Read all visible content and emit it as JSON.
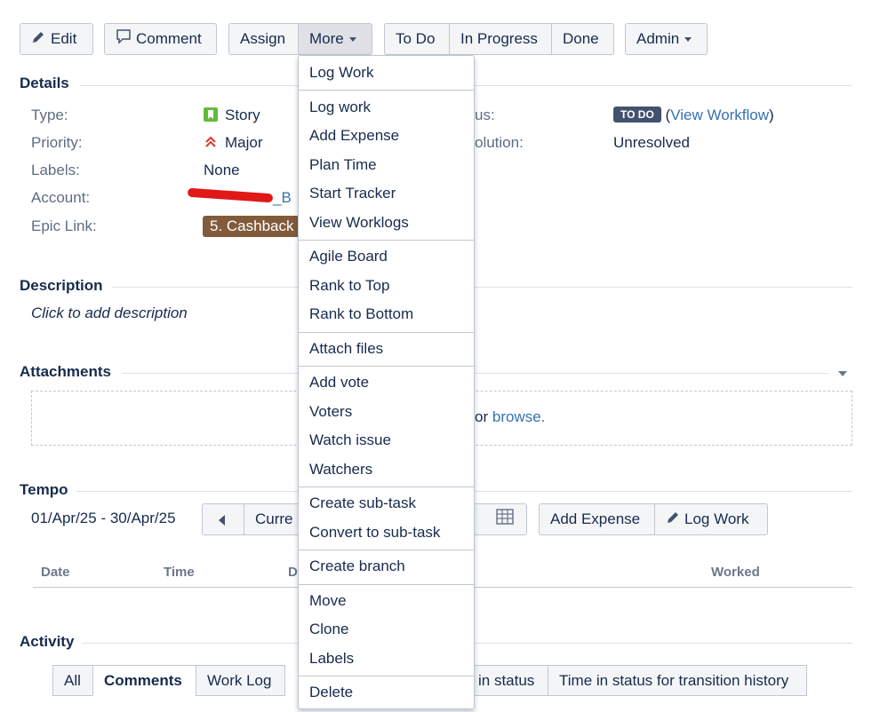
{
  "toolbar": {
    "edit": "Edit",
    "comment": "Comment",
    "assign": "Assign",
    "more": "More",
    "todo": "To Do",
    "in_progress": "In Progress",
    "done": "Done",
    "admin": "Admin"
  },
  "details": {
    "heading": "Details",
    "type_label": "Type:",
    "type_value": "Story",
    "priority_label": "Priority:",
    "priority_value": "Major",
    "labels_label": "Labels:",
    "labels_value": "None",
    "account_label": "Account:",
    "account_value": "_B",
    "epic_label": "Epic Link:",
    "epic_value": "5. Cashback",
    "status_label_partial": "us:",
    "status_badge": "TO DO",
    "workflow_open": "(",
    "workflow_link": "View Workflow",
    "workflow_close": ")",
    "resolution_label_partial": "olution:",
    "resolution_value": "Unresolved"
  },
  "description": {
    "heading": "Description",
    "placeholder": "Click to add description"
  },
  "attachments": {
    "heading": "Attachments",
    "drop_text": "or",
    "browse": "browse."
  },
  "tempo": {
    "heading": "Tempo",
    "range": "01/Apr/25 - 30/Apr/25",
    "current_partial": "Curre",
    "add_expense": "Add Expense",
    "log_work": "Log Work",
    "col_date": "Date",
    "col_time": "Time",
    "col_d": "D",
    "col_worked": "Worked"
  },
  "activity": {
    "heading": "Activity",
    "tabs": [
      "All",
      "Comments",
      "Work Log",
      "in status",
      "Time in status for transition history"
    ]
  },
  "more_menu": {
    "groups": [
      [
        "Log Work"
      ],
      [
        "Log work",
        "Add Expense",
        "Plan Time",
        "Start Tracker",
        "View Worklogs"
      ],
      [
        "Agile Board",
        "Rank to Top",
        "Rank to Bottom"
      ],
      [
        "Attach files"
      ],
      [
        "Add vote",
        "Voters",
        "Watch issue",
        "Watchers"
      ],
      [
        "Create sub-task",
        "Convert to sub-task"
      ],
      [
        "Create branch"
      ],
      [
        "Move",
        "Clone",
        "Labels"
      ],
      [
        "Delete"
      ]
    ]
  },
  "colors": {
    "link": "#3572b0",
    "status_badge_bg": "#42526e",
    "epic_bg": "#815b3a",
    "story_icon": "#63ba3c",
    "priority_icon": "#d04437",
    "redaction": "#e01818"
  }
}
